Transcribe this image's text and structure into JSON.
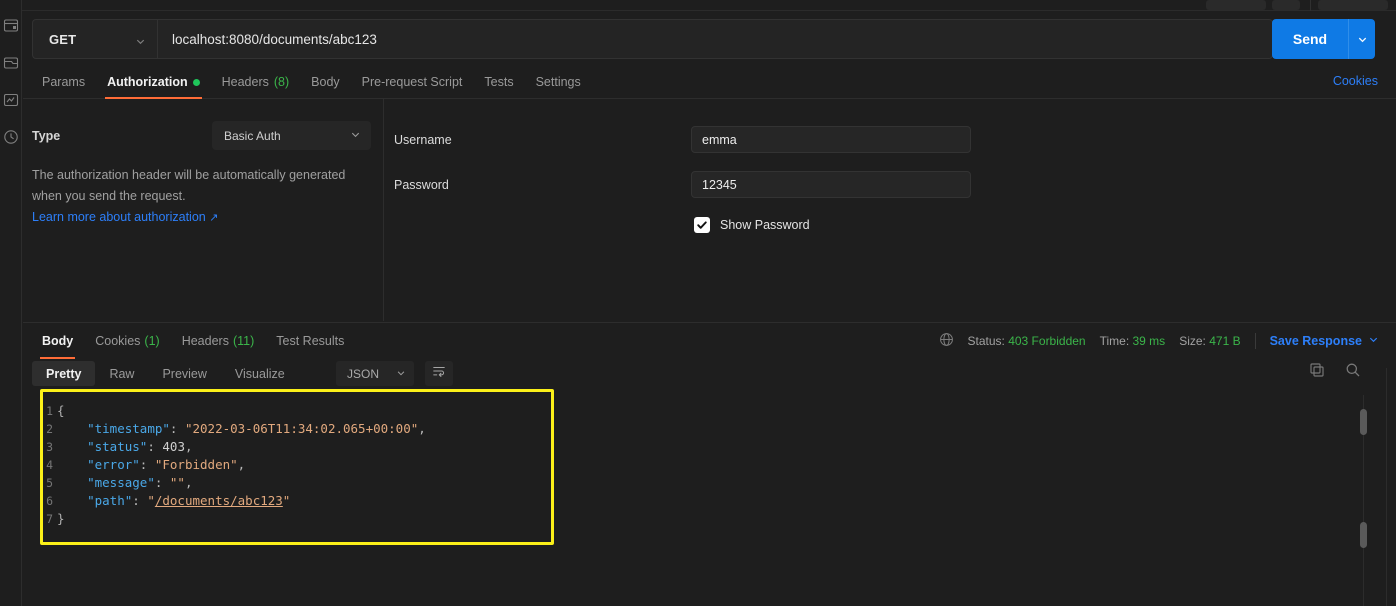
{
  "request": {
    "method": "GET",
    "url": "localhost:8080/documents/abc123",
    "send_label": "Send",
    "tabs": [
      {
        "label": "Params",
        "count": "",
        "dot": false,
        "active": false
      },
      {
        "label": "Authorization",
        "count": "",
        "dot": true,
        "active": true
      },
      {
        "label": "Headers",
        "count": "(8)",
        "dot": false,
        "active": false
      },
      {
        "label": "Body",
        "count": "",
        "dot": false,
        "active": false
      },
      {
        "label": "Pre-request Script",
        "count": "",
        "dot": false,
        "active": false
      },
      {
        "label": "Tests",
        "count": "",
        "dot": false,
        "active": false
      },
      {
        "label": "Settings",
        "count": "",
        "dot": false,
        "active": false
      }
    ],
    "cookies_link": "Cookies"
  },
  "auth": {
    "type_label": "Type",
    "type_value": "Basic Auth",
    "note": "The authorization header will be automatically generated when you send the request.",
    "learn_more": "Learn more about authorization",
    "external_arrow": "↗",
    "username_label": "Username",
    "username_value": "emma",
    "password_label": "Password",
    "password_value": "12345",
    "show_password_label": "Show Password",
    "show_password_checked": true
  },
  "response": {
    "tabs": [
      {
        "label": "Body",
        "count": "",
        "active": true
      },
      {
        "label": "Cookies",
        "count": "(1)",
        "active": false
      },
      {
        "label": "Headers",
        "count": "(11)",
        "active": false
      },
      {
        "label": "Test Results",
        "count": "",
        "active": false
      }
    ],
    "status_label": "Status:",
    "status_value": "403 Forbidden",
    "time_label": "Time:",
    "time_value": "39 ms",
    "size_label": "Size:",
    "size_value": "471 B",
    "save_response": "Save Response",
    "view_modes": [
      "Pretty",
      "Raw",
      "Preview",
      "Visualize"
    ],
    "active_view": "Pretty",
    "format": "JSON",
    "body_lines": [
      {
        "num": "1",
        "indent": 0,
        "tokens": [
          {
            "t": "{",
            "c": "brace"
          }
        ]
      },
      {
        "num": "2",
        "indent": 1,
        "tokens": [
          {
            "t": "\"timestamp\"",
            "c": "k"
          },
          {
            "t": ": ",
            "c": "p"
          },
          {
            "t": "\"2022-03-06T11:34:02.065+00:00\"",
            "c": "s"
          },
          {
            "t": ",",
            "c": "p"
          }
        ]
      },
      {
        "num": "3",
        "indent": 1,
        "tokens": [
          {
            "t": "\"status\"",
            "c": "k"
          },
          {
            "t": ": ",
            "c": "p"
          },
          {
            "t": "403",
            "c": "n"
          },
          {
            "t": ",",
            "c": "p"
          }
        ]
      },
      {
        "num": "4",
        "indent": 1,
        "tokens": [
          {
            "t": "\"error\"",
            "c": "k"
          },
          {
            "t": ": ",
            "c": "p"
          },
          {
            "t": "\"Forbidden\"",
            "c": "s"
          },
          {
            "t": ",",
            "c": "p"
          }
        ]
      },
      {
        "num": "5",
        "indent": 1,
        "tokens": [
          {
            "t": "\"message\"",
            "c": "k"
          },
          {
            "t": ": ",
            "c": "p"
          },
          {
            "t": "\"\"",
            "c": "s"
          },
          {
            "t": ",",
            "c": "p"
          }
        ]
      },
      {
        "num": "6",
        "indent": 1,
        "tokens": [
          {
            "t": "\"path\"",
            "c": "k"
          },
          {
            "t": ": ",
            "c": "p"
          },
          {
            "t": "\"",
            "c": "s"
          },
          {
            "t": "/documents/abc123",
            "c": "url-val"
          },
          {
            "t": "\"",
            "c": "s"
          }
        ]
      },
      {
        "num": "7",
        "indent": 0,
        "tokens": [
          {
            "t": "}",
            "c": "brace"
          }
        ]
      }
    ]
  },
  "sidebar": {
    "items": [
      {
        "name": "collections-icon"
      },
      {
        "name": "environments-icon"
      },
      {
        "name": "flows-icon"
      },
      {
        "name": "history-icon"
      }
    ]
  },
  "colors": {
    "accent_orange": "#ff6c37",
    "link_blue": "#2d7ff9",
    "send_blue": "#0f7ae5",
    "success_green": "#3bb54a",
    "highlight_yellow": "#fbf019",
    "background": "#1e1e1e"
  }
}
